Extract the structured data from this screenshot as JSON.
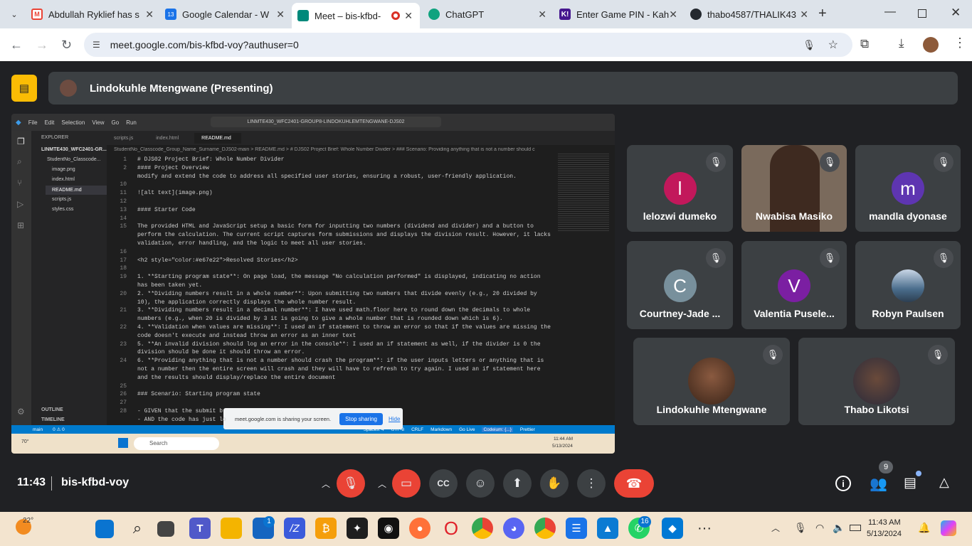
{
  "browser": {
    "tabs": [
      {
        "title": "Abdullah Ryklief has s",
        "icon": "gmail-icon",
        "color": "#ea4335"
      },
      {
        "title": "Google Calendar - W",
        "icon": "calendar-icon",
        "color": "#1a73e8"
      },
      {
        "title": "Meet – bis-kfbd-",
        "icon": "meet-icon",
        "color": "#00897b",
        "active": true
      },
      {
        "title": "ChatGPT",
        "icon": "chatgpt-icon",
        "color": "#10a37f"
      },
      {
        "title": "Enter Game PIN - Kah",
        "icon": "kahoot-icon",
        "color": "#46178f"
      },
      {
        "title": "thabo4587/THALIK43",
        "icon": "github-icon",
        "color": "#24292f"
      }
    ],
    "url": "meet.google.com/bis-kfbd-voy?authuser=0"
  },
  "meet": {
    "presenter": "Lindokuhle Mtengwane (Presenting)",
    "time": "11:43",
    "meeting_code": "bis-kfbd-voy",
    "participant_count": "9",
    "participants": [
      {
        "name": "lelozwi dumeko",
        "initial": "l",
        "color": "#c2185b"
      },
      {
        "name": "Nwabisa Masiko",
        "initial": "",
        "color": "#8d6e63"
      },
      {
        "name": "mandla dyonase",
        "initial": "m",
        "color": "#5e35b1"
      },
      {
        "name": "Courtney-Jade ...",
        "initial": "C",
        "color": "#78909c"
      },
      {
        "name": "Valentia Pusele...",
        "initial": "V",
        "color": "#7b1fa2"
      },
      {
        "name": "Robyn Paulsen",
        "initial": "",
        "color": "#4a6d8c"
      },
      {
        "name": "Lindokuhle Mtengwane",
        "initial": "",
        "color": "#6d4c41"
      },
      {
        "name": "Thabo Likotsi",
        "initial": "",
        "color": "#5d4037"
      }
    ]
  },
  "vscode": {
    "menu": [
      "File",
      "Edit",
      "Selection",
      "View",
      "Go",
      "Run"
    ],
    "search": "LINMTE430_WFC2401-GROUP8-LINDOKUHLEMTENGWANE-DJS02",
    "explorer_title": "EXPLORER",
    "folder": "LINMTE430_WFC2401-GR...",
    "subfolder": "StudentNo_Classcode...",
    "files": [
      "image.png",
      "index.html",
      "README.md",
      "scripts.js",
      "styles.css"
    ],
    "editor_tabs": [
      "scripts.js",
      "index.html",
      "README.md"
    ],
    "breadcrumb": "StudentNo_Classcode_Group_Name_Surname_DJS02-main > README.md > # DJS02 Project Brief: Whole Number Divider > ### Scenario: Providing anything that is not a number should c",
    "line_numbers": "1\n2\n\n10\n11\n12\n13\n14\n15\n\n\n16\n17\n18\n19\n\n20\n\n21\n\n22\n\n23\n\n24\n\n\n25\n26\n27\n28",
    "code": "# DJS02 Project Brief: Whole Number Divider\n#### Project Overview\nmodify and extend the code to address all specified user stories, ensuring a robust, user-friendly application.\n\n![alt text](image.png)\n\n#### Starter Code\n\nThe provided HTML and JavaScript setup a basic form for inputting two numbers (dividend and divider) and a button to\nperform the calculation. The current script captures form submissions and displays the division result. However, it lacks\nvalidation, error handling, and the logic to meet all user stories.\n\n<h2 style=\"color:#e67e22\">Resolved Stories</h2>\n\n1. **Starting program state**: On page load, the message \"No calculation performed\" is displayed, indicating no action\nhas been taken yet.\n2. **Dividing numbers result in a whole number**: Upon submitting two numbers that divide evenly (e.g., 20 divided by\n10), the application correctly displays the whole number result.\n3. **Dividing numbers result in a decimal number**: I have used math.floor here to round down the decimals to whole\nnumbers (e.g., when 20 is divided by 3 it is going to give a whole number that is rounded down which is 6).\n4. **Validation when values are missing**: I used an if statement to throw an error so that if the values are missing the\ncode doesn't execute and instead throw an error as an inner text\n5. **An invalid division should log an error in the console**: I used an if statement as well, if the divider is 0 the\ndivision should be done it should throw an error.\n6. **Providing anything that is not a number should crash the program**: if the user inputs letters or anything that is\nnot a number then the entire screen will crash and they will have to refresh to try again. I used an if statement here\nand the results should display/replace the entire document\n\n### Scenario: Starting program state\n\n- GIVEN that the submit b\n- AND the code has just lo",
    "outline": "OUTLINE",
    "timeline": "TIMELINE",
    "status_branch": "main",
    "status_errors": "0 ⚠ 0",
    "status_right": [
      "Spaces: 4",
      "UTF-8",
      "CRLF",
      "Markdown",
      "Go Live",
      "Codeium: {...}",
      "Prettier"
    ],
    "share_notice": "meet.google.com is sharing your screen.",
    "stop_sharing": "Stop sharing",
    "hide": "Hide",
    "inner_search": "Search",
    "inner_time": "11:44 AM",
    "inner_date": "5/13/2024",
    "inner_temp": "70°"
  },
  "taskbar": {
    "weather": "22°",
    "time": "11:43 AM",
    "date": "5/13/2024",
    "badges": {
      "store": "1",
      "whatsapp": "16"
    }
  }
}
